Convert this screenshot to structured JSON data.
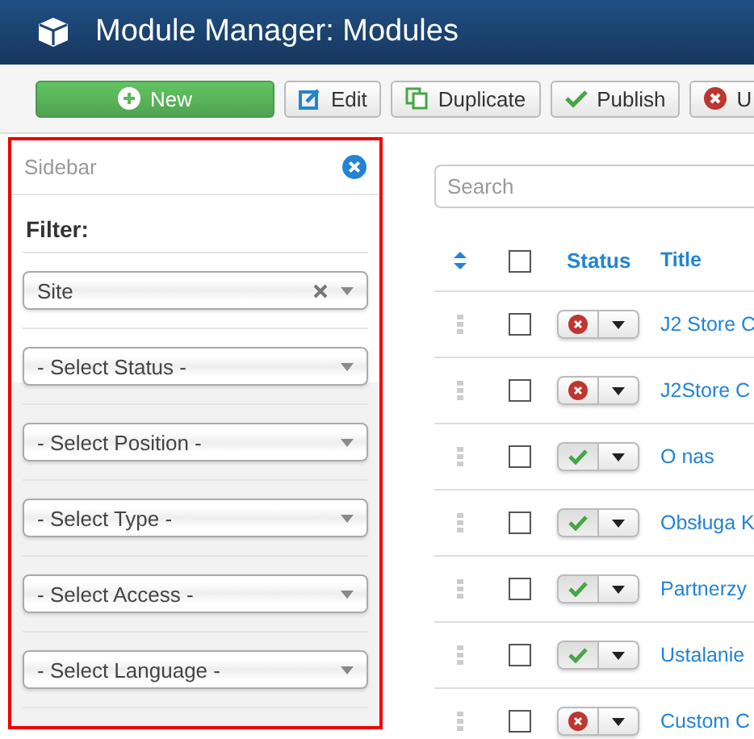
{
  "header": {
    "title": "Module Manager: Modules"
  },
  "toolbar": [
    {
      "kind": "primary",
      "label": "New"
    },
    {
      "kind": "edit",
      "label": "Edit"
    },
    {
      "kind": "duplicate",
      "label": "Duplicate"
    },
    {
      "kind": "publish",
      "label": "Publish"
    },
    {
      "kind": "unpublish",
      "label": "U"
    }
  ],
  "sidebar": {
    "title": "Sidebar",
    "filter_label": "Filter:",
    "filters": [
      {
        "value": "Site",
        "clearable": true
      },
      {
        "value": "- Select Status -",
        "clearable": false
      },
      {
        "value": "- Select Position -",
        "clearable": false
      },
      {
        "value": "- Select Type -",
        "clearable": false
      },
      {
        "value": "- Select Access -",
        "clearable": false
      },
      {
        "value": "- Select Language -",
        "clearable": false
      }
    ]
  },
  "search": {
    "placeholder": "Search"
  },
  "table": {
    "all_checked": false,
    "columns": [
      "Status",
      "Title"
    ],
    "rows": [
      {
        "checked": false,
        "published": false,
        "title": "J2 Store C"
      },
      {
        "checked": false,
        "published": false,
        "title": "J2Store C"
      },
      {
        "checked": false,
        "published": true,
        "title": "O nas"
      },
      {
        "checked": false,
        "published": true,
        "title": "Obsługa K"
      },
      {
        "checked": false,
        "published": true,
        "title": "Partnerzy"
      },
      {
        "checked": false,
        "published": true,
        "title": "Ustalanie"
      },
      {
        "checked": false,
        "published": false,
        "title": "Custom C"
      }
    ]
  }
}
